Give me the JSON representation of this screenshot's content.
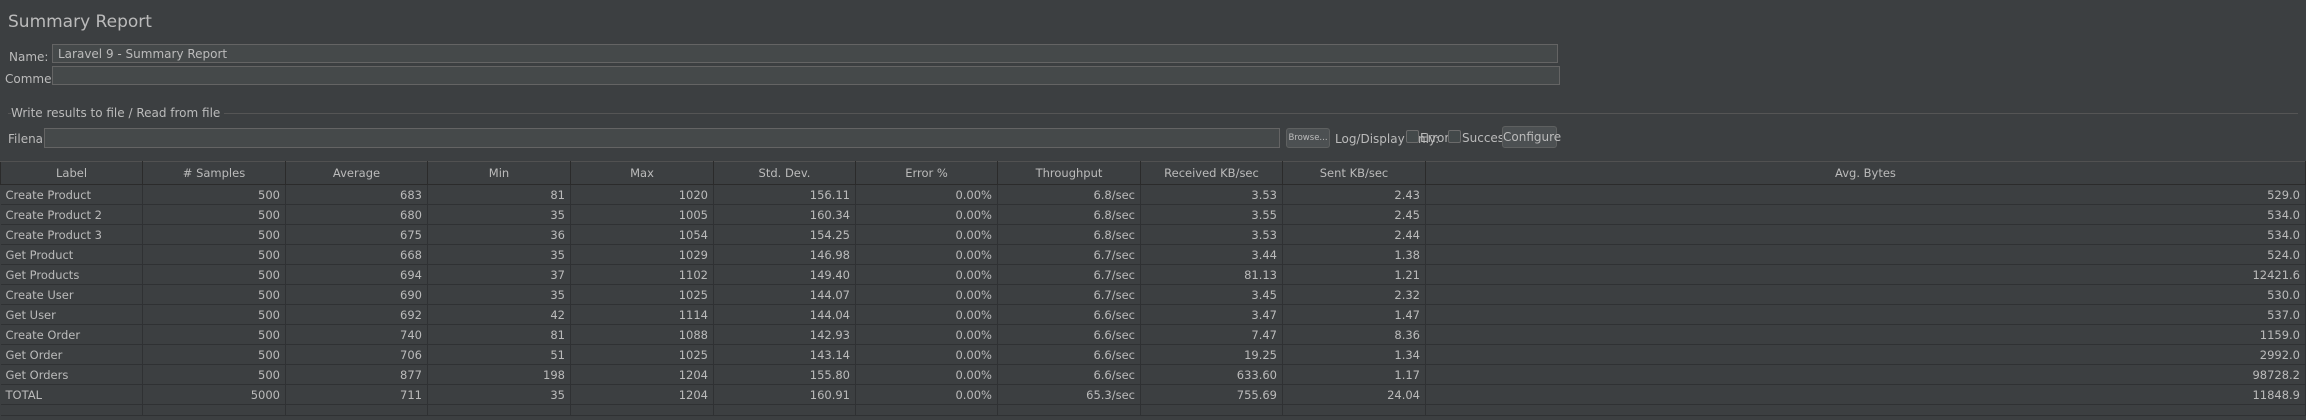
{
  "panel": {
    "title": "Summary Report",
    "name_label": "Name:",
    "name_value": "Laravel 9 - Summary Report",
    "comments_label": "Comments:",
    "comments_value": "",
    "file_group_title": "Write results to file / Read from file",
    "filename_label": "Filename",
    "filename_value": "",
    "browse_label": "Browse...",
    "log_display_label": "Log/Display Only:",
    "errors_label": "Errors",
    "successes_label": "Successes",
    "configure_label": "Configure"
  },
  "table": {
    "columns": [
      "Label",
      "# Samples",
      "Average",
      "Min",
      "Max",
      "Std. Dev.",
      "Error %",
      "Throughput",
      "Received KB/sec",
      "Sent KB/sec",
      "Avg. Bytes"
    ],
    "rows": [
      [
        "Create Product",
        "500",
        "683",
        "81",
        "1020",
        "156.11",
        "0.00%",
        "6.8/sec",
        "3.53",
        "2.43",
        "529.0"
      ],
      [
        "Create Product 2",
        "500",
        "680",
        "35",
        "1005",
        "160.34",
        "0.00%",
        "6.8/sec",
        "3.55",
        "2.45",
        "534.0"
      ],
      [
        "Create Product 3",
        "500",
        "675",
        "36",
        "1054",
        "154.25",
        "0.00%",
        "6.8/sec",
        "3.53",
        "2.44",
        "534.0"
      ],
      [
        "Get Product",
        "500",
        "668",
        "35",
        "1029",
        "146.98",
        "0.00%",
        "6.7/sec",
        "3.44",
        "1.38",
        "524.0"
      ],
      [
        "Get Products",
        "500",
        "694",
        "37",
        "1102",
        "149.40",
        "0.00%",
        "6.7/sec",
        "81.13",
        "1.21",
        "12421.6"
      ],
      [
        "Create User",
        "500",
        "690",
        "35",
        "1025",
        "144.07",
        "0.00%",
        "6.7/sec",
        "3.45",
        "2.32",
        "530.0"
      ],
      [
        "Get User",
        "500",
        "692",
        "42",
        "1114",
        "144.04",
        "0.00%",
        "6.6/sec",
        "3.47",
        "1.47",
        "537.0"
      ],
      [
        "Create Order",
        "500",
        "740",
        "81",
        "1088",
        "142.93",
        "0.00%",
        "6.6/sec",
        "7.47",
        "8.36",
        "1159.0"
      ],
      [
        "Get Order",
        "500",
        "706",
        "51",
        "1025",
        "143.14",
        "0.00%",
        "6.6/sec",
        "19.25",
        "1.34",
        "2992.0"
      ],
      [
        "Get Orders",
        "500",
        "877",
        "198",
        "1204",
        "155.80",
        "0.00%",
        "6.6/sec",
        "633.60",
        "1.17",
        "98728.2"
      ],
      [
        "TOTAL",
        "5000",
        "711",
        "35",
        "1204",
        "160.91",
        "0.00%",
        "65.3/sec",
        "755.69",
        "24.04",
        "11848.9"
      ]
    ]
  }
}
